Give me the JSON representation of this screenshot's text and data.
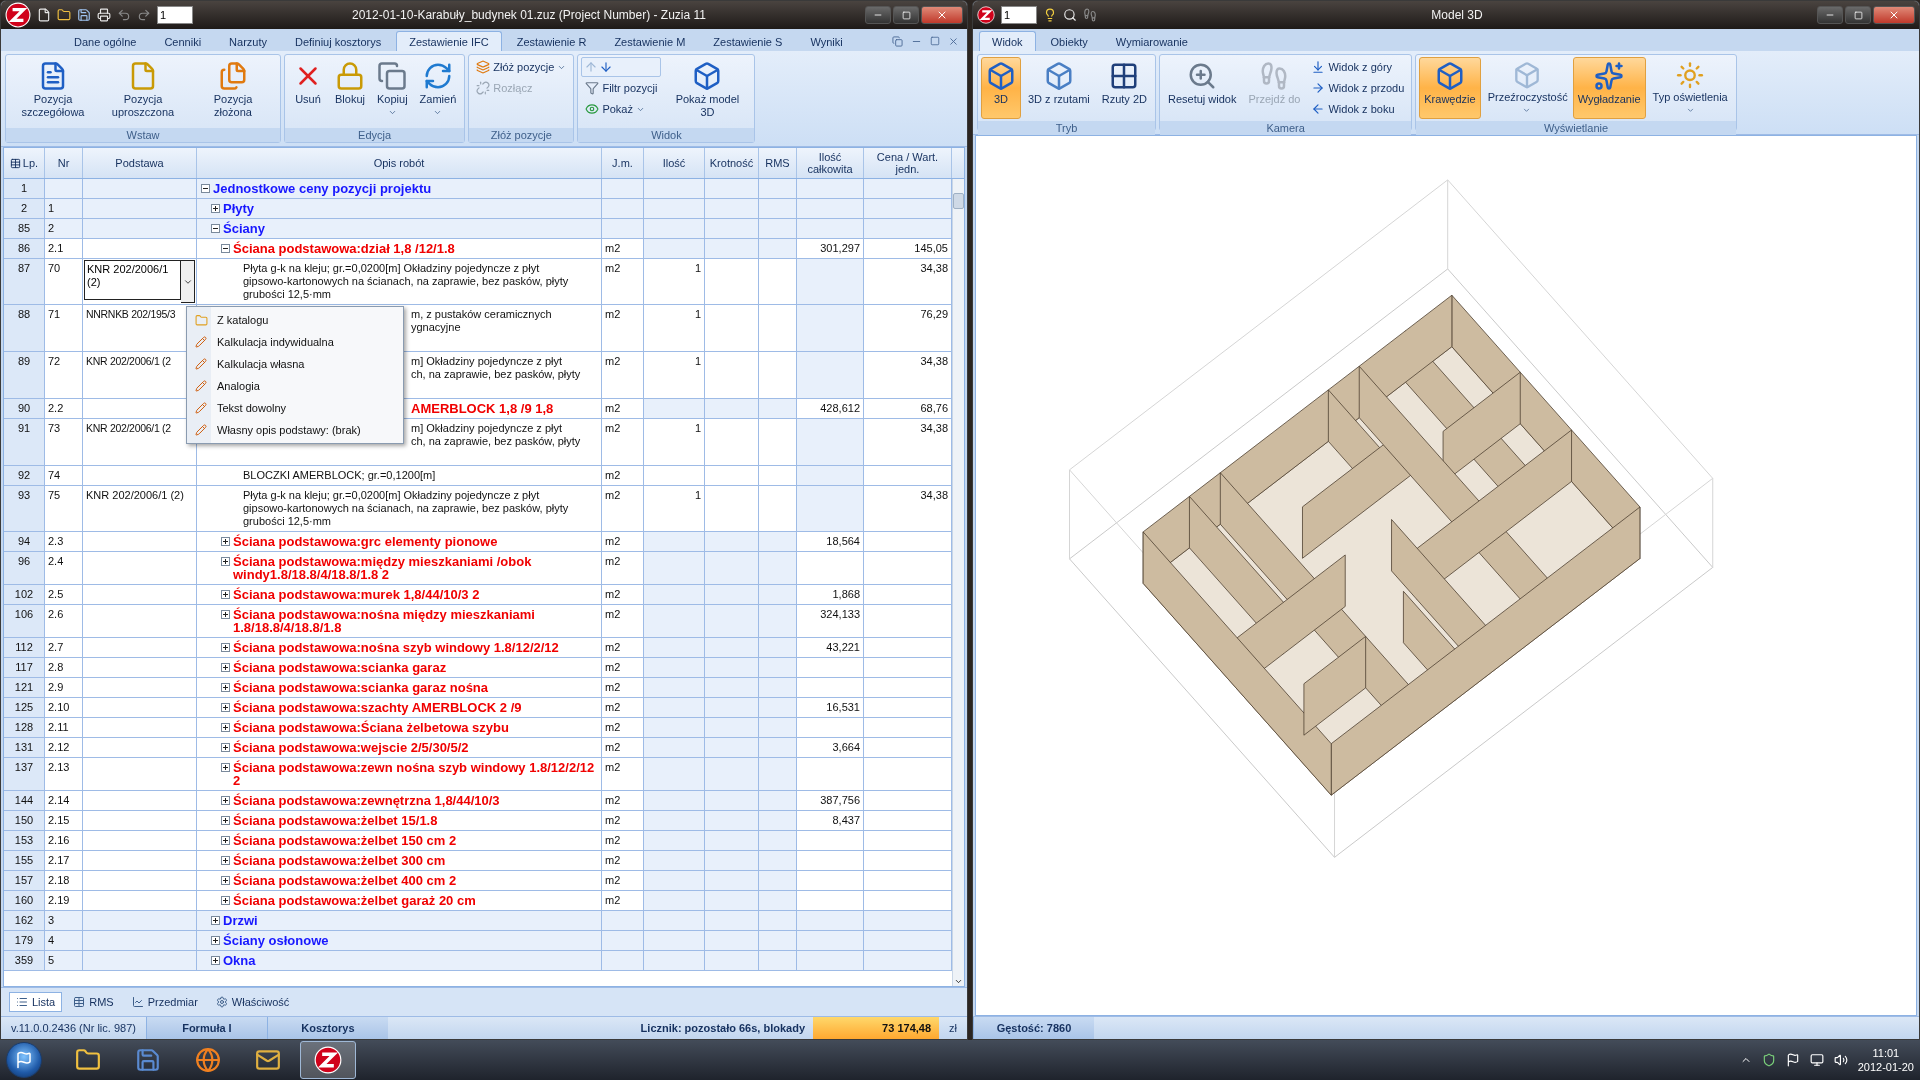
{
  "main_window": {
    "title": "2012-01-10-Karabuły_budynek 01.zuz (Project Number) - Zuzia 11",
    "page_value": "1",
    "tabs": [
      {
        "label": "Dane ogólne",
        "selected": false
      },
      {
        "label": "Cenniki",
        "selected": false
      },
      {
        "label": "Narzuty",
        "selected": false
      },
      {
        "label": "Definiuj kosztorys",
        "selected": false
      },
      {
        "label": "Zestawienie IFC",
        "selected": true
      },
      {
        "label": "Zestawienie R",
        "selected": false
      },
      {
        "label": "Zestawienie M",
        "selected": false
      },
      {
        "label": "Zestawienie S",
        "selected": false
      },
      {
        "label": "Wyniki",
        "selected": false
      }
    ],
    "ribbon_groups": [
      {
        "label": "Wstaw",
        "buttons": [
          {
            "kind": "large",
            "label": "Pozycja szczegółowa",
            "disabled": false,
            "dropdown": false
          },
          {
            "kind": "large",
            "label": "Pozycja uproszczona",
            "disabled": false,
            "dropdown": false
          },
          {
            "kind": "large",
            "label": "Pozycja złożona",
            "disabled": false,
            "dropdown": false
          }
        ]
      },
      {
        "label": "Edycja",
        "buttons": [
          {
            "kind": "large",
            "label": "Usuń",
            "disabled": false,
            "dropdown": false
          },
          {
            "kind": "large",
            "label": "Blokuj",
            "disabled": false,
            "dropdown": false
          },
          {
            "kind": "large",
            "label": "Kopiuj",
            "disabled": false,
            "dropdown": true
          },
          {
            "kind": "large",
            "label": "Zamień",
            "disabled": false,
            "dropdown": true
          }
        ]
      },
      {
        "label": "Złóż pozycje",
        "buttons": [
          {
            "kind": "small",
            "label": "Złóż pozycje",
            "disabled": false,
            "dropdown": true
          },
          {
            "kind": "small",
            "label": "Rozłącz",
            "disabled": true,
            "dropdown": false
          }
        ]
      },
      {
        "label": "Widok",
        "buttons": [
          {
            "kind": "arrows",
            "disabled": false,
            "dropdown": false
          },
          {
            "kind": "small",
            "label": "Filtr pozycji",
            "disabled": false,
            "dropdown": false
          },
          {
            "kind": "small",
            "label": "Pokaż",
            "disabled": false,
            "dropdown": true
          },
          {
            "kind": "large",
            "label": "Pokaż model 3D",
            "disabled": false,
            "dropdown": false
          }
        ]
      }
    ]
  },
  "table": {
    "columns": [
      "Lp.",
      "Nr",
      "Podstawa",
      "Opis robót",
      "J.m.",
      "Ilość",
      "Krotność",
      "RMS",
      "Ilość całkowita",
      "Cena / Wart. jedn."
    ],
    "rows": [
      {
        "lp": "1",
        "kind": "group",
        "desc": "Jednostkowe ceny pozycji projektu",
        "expanded": true,
        "children": [
          {
            "lp": "2",
            "nr": "1",
            "kind": "group",
            "desc": "Płyty",
            "expanded": false
          },
          {
            "lp": "85",
            "nr": "2",
            "kind": "group",
            "desc": "Ściany",
            "expanded": true,
            "children": [
              {
                "lp": "86",
                "nr": "2.1",
                "kind": "element",
                "desc": "Ściana podstawowa:dział 1,8 /12/1.8",
                "unit": "m2",
                "total": "301,297",
                "price": "145,05",
                "expanded": true,
                "children": [
                  {
                    "lp": "87",
                    "nr": "70",
                    "kind": "item",
                    "basis": "KNR 202/2006/1 (2)",
                    "editing": true,
                    "desc": "Płyta g-k na kleju; gr.=0,0200[m] Okładziny pojedyncze z płyt\ngipsowo-kartonowych na ścianach, na zaprawie, bez pasków, płyty\ngrubości 12,5·mm",
                    "unit": "m2",
                    "qty": "1",
                    "price": "34,38"
                  },
                  {
                    "lp": "88",
                    "nr": "71",
                    "kind": "item",
                    "basis": "NNRNKB 202/195/3",
                    "covered": true,
                    "desc": "m, z pustaków ceramicznych\nygnacyjne",
                    "unit": "m2",
                    "qty": "1",
                    "price": "76,29"
                  },
                  {
                    "lp": "89",
                    "nr": "72",
                    "kind": "item",
                    "basis": "KNR 202/2006/1 (2",
                    "covered": true,
                    "desc": "m] Okładziny pojedyncze z płyt\nch, na zaprawie, bez pasków, płyty",
                    "unit": "m2",
                    "qty": "1",
                    "price": "34,38"
                  }
                ]
              },
              {
                "lp": "90",
                "nr": "2.2",
                "kind": "element",
                "covered": true,
                "desc": "AMERBLOCK 1,8 /9 1,8",
                "unit": "m2",
                "total": "428,612",
                "price": "68,76",
                "children": [
                  {
                    "lp": "91",
                    "nr": "73",
                    "kind": "item",
                    "basis": "KNR 202/2006/1 (2",
                    "covered": true,
                    "desc": "m] Okładziny pojedyncze z płyt\nch, na zaprawie, bez pasków, płyty",
                    "unit": "m2",
                    "qty": "1",
                    "price": "34,38"
                  },
                  {
                    "lp": "92",
                    "nr": "74",
                    "kind": "item",
                    "desc": "BLOCZKI AMERBLOCK; gr.=0,1200[m]",
                    "unit": "m2"
                  },
                  {
                    "lp": "93",
                    "nr": "75",
                    "kind": "item",
                    "basis": "KNR 202/2006/1 (2)",
                    "desc": "Płyta g-k na kleju; gr.=0,0200[m] Okładziny pojedyncze z płyt\ngipsowo-kartonowych na ścianach, na zaprawie, bez pasków, płyty\ngrubości 12,5·mm",
                    "unit": "m2",
                    "qty": "1",
                    "price": "34,38"
                  }
                ]
              },
              {
                "lp": "94",
                "nr": "2.3",
                "kind": "element",
                "desc": "Ściana podstawowa:grc  elementy pionowe",
                "unit": "m2",
                "total": "18,564",
                "expanded": false
              },
              {
                "lp": "96",
                "nr": "2.4",
                "kind": "element",
                "desc": "Ściana podstawowa:między mieszkaniami /obok windy1.8/18.8/4/18.8/1.8 2",
                "unit": "m2",
                "expanded": false
              },
              {
                "lp": "102",
                "nr": "2.5",
                "kind": "element",
                "desc": "Ściana podstawowa:murek 1,8/44/10/3 2",
                "unit": "m2",
                "total": "1,868",
                "expanded": false
              },
              {
                "lp": "106",
                "nr": "2.6",
                "kind": "element",
                "desc": "Ściana podstawowa:nośna między mieszkaniami 1.8/18.8/4/18.8/1.8",
                "unit": "m2",
                "total": "324,133",
                "expanded": false
              },
              {
                "lp": "112",
                "nr": "2.7",
                "kind": "element",
                "desc": "Ściana podstawowa:nośna szyb windowy 1.8/12/2/12",
                "unit": "m2",
                "total": "43,221",
                "expanded": false
              },
              {
                "lp": "117",
                "nr": "2.8",
                "kind": "element",
                "desc": "Ściana podstawowa:scianka garaz",
                "unit": "m2",
                "expanded": false
              },
              {
                "lp": "121",
                "nr": "2.9",
                "kind": "element",
                "desc": "Ściana podstawowa:scianka garaz nośna",
                "unit": "m2",
                "expanded": false
              },
              {
                "lp": "125",
                "nr": "2.10",
                "kind": "element",
                "desc": "Ściana podstawowa:szachty AMERBLOCK 2 /9",
                "unit": "m2",
                "total": "16,531",
                "expanded": false
              },
              {
                "lp": "128",
                "nr": "2.11",
                "kind": "element",
                "desc": "Ściana podstawowa:Ściana żelbetowa szybu",
                "unit": "m2",
                "expanded": false
              },
              {
                "lp": "131",
                "nr": "2.12",
                "kind": "element",
                "desc": "Ściana podstawowa:wejscie 2/5/30/5/2",
                "unit": "m2",
                "total": "3,664",
                "expanded": false
              },
              {
                "lp": "137",
                "nr": "2.13",
                "kind": "element",
                "desc": "Ściana podstawowa:zewn nośna szyb windowy 1.8/12/2/12 2",
                "unit": "m2",
                "expanded": false
              },
              {
                "lp": "144",
                "nr": "2.14",
                "kind": "element",
                "desc": "Ściana podstawowa:zewnętrzna 1,8/44/10/3",
                "unit": "m2",
                "total": "387,756",
                "expanded": false
              },
              {
                "lp": "150",
                "nr": "2.15",
                "kind": "element",
                "desc": "Ściana podstawowa:żelbet 15/1.8",
                "unit": "m2",
                "total": "8,437",
                "expanded": false
              },
              {
                "lp": "153",
                "nr": "2.16",
                "kind": "element",
                "desc": "Ściana podstawowa:żelbet 150 cm 2",
                "unit": "m2",
                "expanded": false
              },
              {
                "lp": "155",
                "nr": "2.17",
                "kind": "element",
                "desc": "Ściana podstawowa:żelbet 300 cm",
                "unit": "m2",
                "expanded": false
              },
              {
                "lp": "157",
                "nr": "2.18",
                "kind": "element",
                "desc": "Ściana podstawowa:żelbet 400 cm 2",
                "unit": "m2",
                "expanded": false
              },
              {
                "lp": "160",
                "nr": "2.19",
                "kind": "element",
                "desc": "Ściana podstawowa:żelbet garaż  20 cm",
                "unit": "m2",
                "expanded": false
              }
            ]
          },
          {
            "lp": "162",
            "nr": "3",
            "kind": "group",
            "desc": "Drzwi",
            "expanded": false
          },
          {
            "lp": "179",
            "nr": "4",
            "kind": "group",
            "desc": "Ściany osłonowe",
            "expanded": false
          },
          {
            "lp": "359",
            "nr": "5",
            "kind": "group",
            "desc": "Okna",
            "expanded": false
          }
        ]
      }
    ]
  },
  "context_menu": [
    {
      "label": "Z katalogu"
    },
    {
      "label": "Kalkulacja indywidualna"
    },
    {
      "label": "Kalkulacja własna"
    },
    {
      "label": "Analogia"
    },
    {
      "label": "Tekst dowolny"
    },
    {
      "label": "Własny opis podstawy: (brak)"
    }
  ],
  "bottom_tabs": [
    {
      "label": "Lista",
      "selected": true
    },
    {
      "label": "RMS",
      "selected": false
    },
    {
      "label": "Przedmiar",
      "selected": false
    },
    {
      "label": "Właściwość",
      "selected": false
    }
  ],
  "status_bar": [
    {
      "kind": "plain",
      "text": "v.11.0.0.2436 (Nr lic. 987)"
    },
    {
      "kind": "panel",
      "text": "Formuła I"
    },
    {
      "kind": "panel",
      "text": "Kosztorys"
    },
    {
      "kind": "label",
      "text": "Licznik: pozostało 66s, blokady"
    },
    {
      "kind": "amount",
      "text": "73 174,48"
    },
    {
      "kind": "plain",
      "text": "zł"
    }
  ],
  "model_window": {
    "title": "Model 3D",
    "page_value": "1",
    "tabs": [
      {
        "label": "Widok",
        "selected": true
      },
      {
        "label": "Obiekty",
        "selected": false
      },
      {
        "label": "Wymiarowanie",
        "selected": false
      }
    ],
    "ribbon_groups": [
      {
        "label": "Tryb",
        "buttons": [
          {
            "kind": "large",
            "label": "3D",
            "on": true,
            "disabled": false,
            "dropdown": false
          },
          {
            "kind": "large",
            "label": "3D z rzutami",
            "on": false,
            "disabled": false,
            "dropdown": false
          },
          {
            "kind": "large",
            "label": "Rzuty 2D",
            "on": false,
            "disabled": false,
            "dropdown": false
          }
        ]
      },
      {
        "label": "Kamera",
        "buttons": [
          {
            "kind": "large",
            "label": "Resetuj widok",
            "on": false,
            "disabled": false,
            "dropdown": false
          },
          {
            "kind": "large",
            "label": "Przejdź do",
            "on": false,
            "disabled": true,
            "dropdown": false
          },
          {
            "kind": "small",
            "label": "Widok z góry",
            "on": false,
            "disabled": false,
            "dropdown": false
          },
          {
            "kind": "small",
            "label": "Widok z przodu",
            "on": false,
            "disabled": false,
            "dropdown": false
          },
          {
            "kind": "small",
            "label": "Widok z boku",
            "on": false,
            "disabled": false,
            "dropdown": false
          }
        ]
      },
      {
        "label": "Wyświetlanie",
        "buttons": [
          {
            "kind": "large",
            "label": "Krawędzie",
            "on": true,
            "disabled": false,
            "dropdown": false
          },
          {
            "kind": "large",
            "label": "Przeźroczystość",
            "on": false,
            "disabled": false,
            "dropdown": true
          },
          {
            "kind": "large",
            "label": "Wygładzanie",
            "on": true,
            "disabled": false,
            "dropdown": false
          },
          {
            "kind": "large",
            "label": "Typ oświetlenia",
            "on": false,
            "disabled": false,
            "dropdown": true
          }
        ]
      }
    ],
    "status": "Gęstość: 7860"
  },
  "taskbar": {
    "apps": [
      {
        "selected": false
      },
      {
        "selected": false
      },
      {
        "selected": false
      },
      {
        "selected": false
      },
      {
        "selected": true
      }
    ],
    "time": "11:01",
    "date": "2012-01-20"
  }
}
